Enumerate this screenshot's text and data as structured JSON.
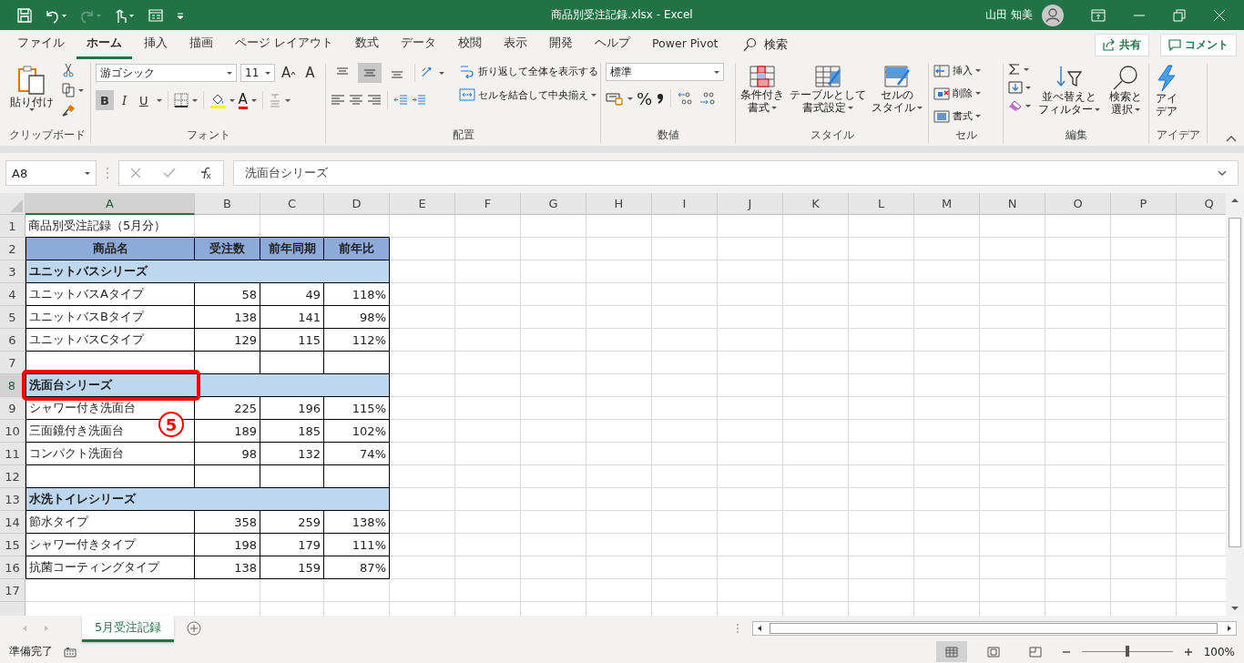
{
  "window": {
    "title": "商品別受注記録.xlsx  -  Excel",
    "user": "山田 知美"
  },
  "menu_tabs": [
    {
      "label": "ファイル",
      "selected": false
    },
    {
      "label": "ホーム",
      "selected": true
    },
    {
      "label": "挿入",
      "selected": false
    },
    {
      "label": "描画",
      "selected": false
    },
    {
      "label": "ページ レイアウト",
      "selected": false
    },
    {
      "label": "数式",
      "selected": false
    },
    {
      "label": "データ",
      "selected": false
    },
    {
      "label": "校閲",
      "selected": false
    },
    {
      "label": "表示",
      "selected": false
    },
    {
      "label": "開発",
      "selected": false
    },
    {
      "label": "ヘルプ",
      "selected": false
    },
    {
      "label": "Power Pivot",
      "selected": false
    }
  ],
  "search": {
    "label": "検索"
  },
  "share_button": "共有",
  "comment_button": "コメント",
  "ribbon": {
    "clipboard": {
      "paste": "貼り付け",
      "label": "クリップボード"
    },
    "font": {
      "name": "游ゴシック",
      "size": "11",
      "grow": "A",
      "shrink": "A",
      "styles": [
        {
          "label": "B",
          "selected": true
        },
        {
          "label": "I",
          "selected": false
        },
        {
          "label": "U",
          "selected": false
        }
      ],
      "font_color": "A",
      "label": "フォント"
    },
    "alignment": {
      "vertical_align": [
        {
          "selected": false
        },
        {
          "selected": true
        },
        {
          "selected": false
        }
      ],
      "wrap": "折り返して全体を表示する",
      "merge": "セルを結合して中央揃え",
      "label": "配置"
    },
    "number": {
      "format": "標準",
      "percent": "%",
      "label": "数値"
    },
    "styles": {
      "buttons": [
        {
          "kind": "conditional",
          "lines": [
            "条件付き",
            "書式"
          ]
        },
        {
          "kind": "table",
          "lines": [
            "テーブルとして",
            "書式設定"
          ]
        },
        {
          "kind": "cell",
          "lines": [
            "セルの",
            "スタイル"
          ]
        }
      ],
      "label": "スタイル"
    },
    "cells": {
      "items": [
        {
          "kind": "insert",
          "label": "挿入"
        },
        {
          "kind": "delete",
          "label": "削除"
        },
        {
          "kind": "format",
          "label": "書式"
        }
      ],
      "label": "セル"
    },
    "editing": {
      "sort": [
        "並べ替えと",
        "フィルター"
      ],
      "find": [
        "検索と",
        "選択"
      ],
      "label": "編集"
    },
    "ideas": {
      "lines": [
        "アイ",
        "デア"
      ],
      "label": "アイデア"
    }
  },
  "formula_bar": {
    "name_box": "A8",
    "content": "洗面台シリーズ"
  },
  "columns": [
    {
      "label": "A",
      "selected": true
    },
    {
      "label": "B",
      "selected": false
    },
    {
      "label": "C",
      "selected": false
    },
    {
      "label": "D",
      "selected": false
    },
    {
      "label": "E",
      "selected": false
    },
    {
      "label": "F",
      "selected": false
    },
    {
      "label": "G",
      "selected": false
    },
    {
      "label": "H",
      "selected": false
    },
    {
      "label": "I",
      "selected": false
    },
    {
      "label": "J",
      "selected": false
    },
    {
      "label": "K",
      "selected": false
    },
    {
      "label": "L",
      "selected": false
    },
    {
      "label": "M",
      "selected": false
    },
    {
      "label": "N",
      "selected": false
    },
    {
      "label": "O",
      "selected": false
    },
    {
      "label": "P",
      "selected": false
    },
    {
      "label": "Q",
      "selected": false
    }
  ],
  "rows": [
    {
      "number": "1",
      "selected": false,
      "kind": "title",
      "cells": [
        "商品別受注記録（5月分）"
      ]
    },
    {
      "number": "2",
      "selected": false,
      "kind": "header",
      "cells": [
        "商品名",
        "受注数",
        "前年同期",
        "前年比"
      ]
    },
    {
      "number": "3",
      "selected": false,
      "kind": "section",
      "cells": [
        "ユニットバスシリーズ"
      ]
    },
    {
      "number": "4",
      "selected": false,
      "kind": "data",
      "cells": [
        "ユニットバスAタイプ",
        "58",
        "49",
        "118%"
      ]
    },
    {
      "number": "5",
      "selected": false,
      "kind": "data",
      "cells": [
        "ユニットバスBタイプ",
        "138",
        "141",
        "98%"
      ]
    },
    {
      "number": "6",
      "selected": false,
      "kind": "data",
      "cells": [
        "ユニットバスCタイプ",
        "129",
        "115",
        "112%"
      ]
    },
    {
      "number": "7",
      "selected": false,
      "kind": "blank"
    },
    {
      "number": "8",
      "selected": true,
      "kind": "section",
      "cells": [
        "洗面台シリーズ"
      ]
    },
    {
      "number": "9",
      "selected": false,
      "kind": "data",
      "cells": [
        "シャワー付き洗面台",
        "225",
        "196",
        "115%"
      ]
    },
    {
      "number": "10",
      "selected": false,
      "kind": "data",
      "cells": [
        "三面鏡付き洗面台",
        "189",
        "185",
        "102%"
      ]
    },
    {
      "number": "11",
      "selected": false,
      "kind": "data",
      "cells": [
        "コンパクト洗面台",
        "98",
        "132",
        "74%"
      ]
    },
    {
      "number": "12",
      "selected": false,
      "kind": "blank"
    },
    {
      "number": "13",
      "selected": false,
      "kind": "section",
      "cells": [
        "水洗トイレシリーズ"
      ]
    },
    {
      "number": "14",
      "selected": false,
      "kind": "data",
      "cells": [
        "節水タイプ",
        "358",
        "259",
        "138%"
      ]
    },
    {
      "number": "15",
      "selected": false,
      "kind": "data",
      "cells": [
        "シャワー付きタイプ",
        "198",
        "179",
        "111%"
      ]
    },
    {
      "number": "16",
      "selected": false,
      "kind": "data",
      "cells": [
        "抗菌コーティングタイプ",
        "138",
        "159",
        "87%"
      ]
    },
    {
      "number": "17",
      "selected": false,
      "kind": "empty"
    }
  ],
  "callout": {
    "number": "5"
  },
  "sheet_tabs": [
    {
      "label": "5月受注記録",
      "selected": true
    }
  ],
  "status_bar": {
    "text": "準備完了",
    "views": [
      {
        "kind": "normal",
        "selected": true
      },
      {
        "kind": "page_layout",
        "selected": false
      },
      {
        "kind": "page_break",
        "selected": false
      }
    ],
    "level": 0.5,
    "zoom": "100%"
  }
}
